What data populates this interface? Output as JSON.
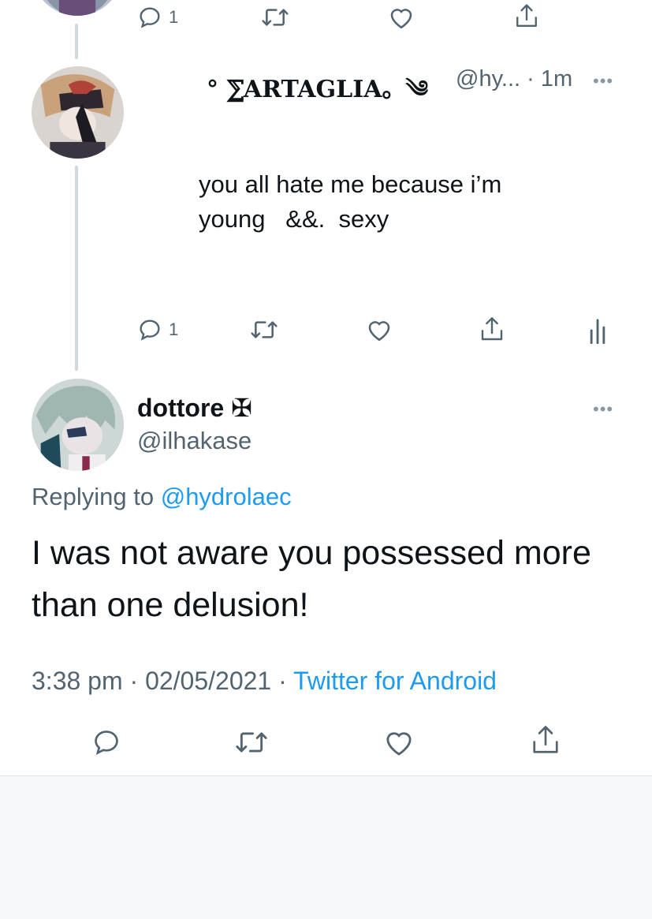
{
  "top_tweet_partial": {
    "reply_count": "1"
  },
  "tweet_tartaglia": {
    "display_name": "° ⅀ARTAGLIA。༄",
    "handle_time": "@hy... · 1m",
    "more_label": "•••",
    "text": "you all hate me because i’m\nyoung   &&.  sexy",
    "reply_count": "1"
  },
  "tweet_dottore": {
    "display_name": "dottore ✠",
    "handle": "@ilhakase",
    "more_label": "•••",
    "replying_prefix": "Replying to ",
    "replying_mention": "@hydrolaec",
    "text": "I was not aware you possessed more than one delusion!",
    "meta_time": "3:38 pm · 02/05/2021 · ",
    "meta_source": "Twitter for Android"
  },
  "icons": {
    "reply": "reply-icon",
    "retweet": "retweet-icon",
    "like": "heart-icon",
    "share": "share-icon",
    "analytics": "analytics-icon"
  },
  "colors": {
    "text_primary": "#0f1419",
    "text_secondary": "#536471",
    "link": "#1d9bf0",
    "thread_line": "#cfd9de"
  }
}
